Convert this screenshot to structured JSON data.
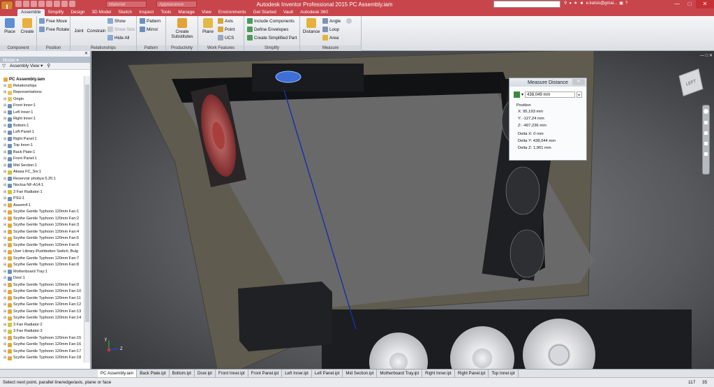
{
  "window": {
    "title": "Autodesk Inventor Professional 2015   PC Assembly.iam",
    "material_placeholder": "Material",
    "appearance_placeholder": "Appearance",
    "user": "e.katsis@gmai..."
  },
  "menubar": [
    "Assemble",
    "Simplify",
    "Design",
    "3D Model",
    "Sketch",
    "Inspect",
    "Tools",
    "Manage",
    "View",
    "Environments",
    "Get Started",
    "Vault",
    "Autodesk 360"
  ],
  "ribbon": {
    "component": {
      "label": "Component",
      "place": "Place",
      "create": "Create"
    },
    "position": {
      "label": "Position",
      "free_move": "Free Move",
      "free_rotate": "Free Rotate"
    },
    "relationships": {
      "label": "Relationships",
      "joint": "Joint",
      "constrain": "Constrain",
      "show": "Show",
      "show_sick": "Show Sick",
      "hide_all": "Hide All"
    },
    "pattern": {
      "label": "Pattern",
      "pattern": "Pattern",
      "mirror": "Mirror"
    },
    "productivity": {
      "label": "Productivity",
      "create_substitutes": "Create Substitutes"
    },
    "work_features": {
      "label": "Work Features",
      "plane": "Plane",
      "axis": "Axis",
      "point": "Point",
      "ucs": "UCS"
    },
    "simplify": {
      "label": "Simplify",
      "include": "Include Components",
      "define_envelopes": "Define Envelopes",
      "create_simplified": "Create Simplified Part"
    },
    "measure": {
      "label": "Measure",
      "distance": "Distance",
      "angle": "Angle",
      "loop": "Loop",
      "area": "Area"
    }
  },
  "browser": {
    "title": "Model",
    "view": "Assembly View",
    "root": "PC Assembly.iam",
    "items": [
      "Relationships",
      "Representations",
      "Origin",
      "Front Inner:1",
      "Left Inner:1",
      "Right Inner:1",
      "Bottom:1",
      "Left Panel:1",
      "Right Panel:1",
      "Top Inner:1",
      "Back Plate:1",
      "Front Panel:1",
      "Mid Section:1",
      "Akasa FC_Six:1",
      "Reservoir phobya 5.25:1",
      "Noctua NF-A14:1",
      "3 Fan Radiator:1",
      "PSU:1",
      "Assem4:1",
      "Scythe Gentle Typhoon 120mm Fan:1",
      "Scythe Gentle Typhoon 120mm Fan:2",
      "Scythe Gentle Typhoon 120mm Fan:3",
      "Scythe Gentle Typhoon 120mm Fan:4",
      "Scythe Gentle Typhoon 120mm Fan:5",
      "Scythe Gentle Typhoon 120mm Fan:6",
      "User Library-Pushbutton Switch, Bulg",
      "Scythe Gentle Typhoon 120mm Fan:7",
      "Scythe Gentle Typhoon 120mm Fan:8",
      "Motherboard Tray:1",
      "Door:1",
      "Scythe Gentle Typhoon 120mm Fan:9",
      "Scythe Gentle Typhoon 120mm Fan:10",
      "Scythe Gentle Typhoon 120mm Fan:11",
      "Scythe Gentle Typhoon 120mm Fan:12",
      "Scythe Gentle Typhoon 120mm Fan:13",
      "Scythe Gentle Typhoon 120mm Fan:14",
      "3 Fan Radiator:2",
      "3 Fan Radiator:3",
      "Scythe Gentle Typhoon 120mm Fan:15",
      "Scythe Gentle Typhoon 120mm Fan:16",
      "Scythe Gentle Typhoon 120mm Fan:17",
      "Scythe Gentle Typhoon 120mm Fan:18"
    ]
  },
  "measure": {
    "title": "Measure Distance",
    "value": "438,049 mm",
    "position_label": "Position",
    "x": "X: 95,193 mm",
    "y": "Y: -127,24 mm",
    "z": "Z: -497,236 mm",
    "dx": "Delta X: 0 mm",
    "dy": "Delta Y: 438,044 mm",
    "dz": "Delta Z: 1,961 mm"
  },
  "viewcube_label": "LEFT",
  "triad": {
    "y": "y",
    "z": "Z"
  },
  "tabs": [
    "PC Assembly.iam",
    "Back Plate.ipt",
    "Bottom.ipt",
    "Door.ipt",
    "Front Inner.ipt",
    "Front Panel.ipt",
    "Left Inner.ipt",
    "Left Panel.ipt",
    "Mid Section.ipt",
    "Motherboard Tray.ipt",
    "Right Inner.ipt",
    "Right Panel.ipt",
    "Top Inner.ipt"
  ],
  "status": {
    "message": "Select next point, parallel line/edge/axis, plane or face",
    "n1": "117",
    "n2": "35"
  },
  "colors": {
    "accent": "#c8454c",
    "frame": "#5f5b4e",
    "fan_red": "#a13b3c",
    "fan_white": "#e6e7e9",
    "measure_line": "#1a2fa8"
  }
}
